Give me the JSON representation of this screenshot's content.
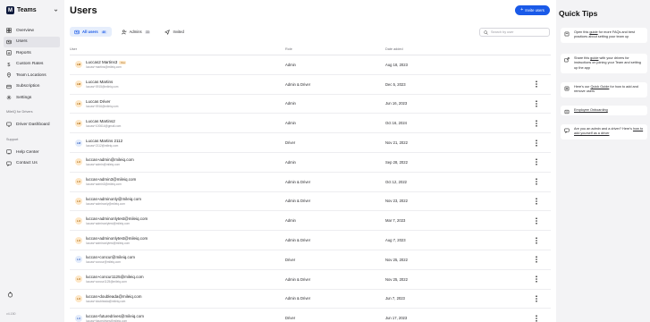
{
  "app": {
    "name": "Teams",
    "logo_letter": "M"
  },
  "sidebar": {
    "items": [
      {
        "label": "Overview",
        "icon": "grid-icon",
        "active": false
      },
      {
        "label": "Users",
        "icon": "users-icon",
        "active": true
      },
      {
        "label": "Reports",
        "icon": "chart-icon",
        "active": false
      },
      {
        "label": "Custom Rates",
        "icon": "dollar-icon",
        "active": false
      },
      {
        "label": "Team Locations",
        "icon": "pin-icon",
        "active": false
      },
      {
        "label": "Subscription",
        "icon": "card-icon",
        "active": false
      },
      {
        "label": "Settings",
        "icon": "gear-icon",
        "active": false
      }
    ],
    "drivers_section_label": "MileIQ for Drivers",
    "drivers_items": [
      {
        "label": "Driver Dashboard",
        "icon": "monitor-icon"
      }
    ],
    "support_section_label": "Support",
    "support_items": [
      {
        "label": "Help Center",
        "icon": "help-icon"
      },
      {
        "label": "Contact Us",
        "icon": "chat-icon"
      }
    ],
    "version": "v4.150"
  },
  "main": {
    "title": "Users",
    "invite_label": "Invite users",
    "tabs": [
      {
        "label": "All users",
        "count": "40",
        "active": true,
        "icon": "users-icon"
      },
      {
        "label": "Admins",
        "count": "33",
        "active": false,
        "icon": "admin-icon"
      },
      {
        "label": "Invited",
        "count": "",
        "active": false,
        "icon": "send-icon"
      }
    ],
    "search_placeholder": "Search by user",
    "columns": {
      "user": "User",
      "role": "Role",
      "date": "Date added"
    },
    "rows": [
      {
        "initials": "LM",
        "name": "Luccas2 Martins3",
        "email": "luccas+martins@mileiq.com",
        "you": true,
        "role": "Admin",
        "date": "Aug 18, 2023",
        "avatar_bg": "#fde7c7",
        "avatar_fg": "#b0690c"
      },
      {
        "initials": "LM",
        "name": "Luccas Martins",
        "email": "luccas+0915@mileiq.com",
        "you": false,
        "role": "Admin & Driver",
        "date": "Dec 5, 2023",
        "avatar_bg": "#fde7c7",
        "avatar_fg": "#b0690c"
      },
      {
        "initials": "LD",
        "name": "Luccas Driver",
        "email": "luccas+0916@mileiq.com",
        "you": false,
        "role": "Admin",
        "date": "Jun 16, 2023",
        "avatar_bg": "#fde7c7",
        "avatar_fg": "#b0690c"
      },
      {
        "initials": "LM",
        "name": "Luccas Martins2",
        "email": "luccas+100614@gmail.com",
        "you": false,
        "role": "Admin",
        "date": "Oct 16, 2024",
        "avatar_bg": "#fde7c7",
        "avatar_fg": "#b0690c"
      },
      {
        "initials": "LM",
        "name": "Luccas Martins 2112",
        "email": "luccas+2112@mileiq.com",
        "you": false,
        "role": "Driver",
        "date": "Nov 21, 2022",
        "avatar_bg": "#e2ebfb",
        "avatar_fg": "#3b67c4"
      },
      {
        "initials": "LU",
        "name": "luccas+admin@mileiq.com",
        "email": "luccas+admin@mileiq.com",
        "you": false,
        "role": "Admin",
        "date": "Sep 28, 2022",
        "avatar_bg": "#fde7c7",
        "avatar_fg": "#b0690c"
      },
      {
        "initials": "LU",
        "name": "luccas+admin3@mileiq.com",
        "email": "luccas+admin3@mileiq.com",
        "you": false,
        "role": "Admin & Driver",
        "date": "Oct 12, 2022",
        "avatar_bg": "#fde7c7",
        "avatar_fg": "#b0690c"
      },
      {
        "initials": "LU",
        "name": "luccas+adminonly@mileiq.com",
        "email": "luccas+adminonly@mileiq.com",
        "you": false,
        "role": "Admin & Driver",
        "date": "Nov 23, 2022",
        "avatar_bg": "#fde7c7",
        "avatar_fg": "#b0690c"
      },
      {
        "initials": "LU",
        "name": "luccas+adminonlytest@mileiq.com",
        "email": "luccas+adminonlytest@mileiq.com",
        "you": false,
        "role": "Admin",
        "date": "Mar 7, 2023",
        "avatar_bg": "#fde7c7",
        "avatar_fg": "#b0690c"
      },
      {
        "initials": "LU",
        "name": "luccas+adminonlytest@mileiq.com",
        "email": "luccas+adminonlytest@mileiq.com",
        "you": false,
        "role": "Admin & Driver",
        "date": "Aug 7, 2023",
        "avatar_bg": "#fde7c7",
        "avatar_fg": "#b0690c"
      },
      {
        "initials": "LU",
        "name": "luccas+concur@mileiq.com",
        "email": "luccas+concur@mileiq.com",
        "you": false,
        "role": "Driver",
        "date": "Nov 25, 2022",
        "avatar_bg": "#e2ebfb",
        "avatar_fg": "#3b67c4"
      },
      {
        "initials": "LU",
        "name": "luccas+concur1125@mileiq.com",
        "email": "luccas+concur1125@mileiq.com",
        "you": false,
        "role": "Admin & Driver",
        "date": "Nov 25, 2022",
        "avatar_bg": "#fde7c7",
        "avatar_fg": "#b0690c"
      },
      {
        "initials": "LU",
        "name": "luccas+doubleada@mileiq.com",
        "email": "luccas+doubleada@mileiq.com",
        "you": false,
        "role": "Admin & Driver",
        "date": "Jun 7, 2023",
        "avatar_bg": "#fde7c7",
        "avatar_fg": "#b0690c"
      },
      {
        "initials": "LU",
        "name": "luccas+futuredrives@mileiq.com",
        "email": "luccas+futuredrives@mileiq.com",
        "you": false,
        "role": "Driver",
        "date": "Jun 17, 2023",
        "avatar_bg": "#e2ebfb",
        "avatar_fg": "#3b67c4"
      }
    ],
    "you_badge": "You"
  },
  "quick_tips": {
    "title": "Quick Tips",
    "tips": [
      {
        "pre": "Open this ",
        "link": "guide",
        "post": " for more FAQs and best practices about setting your team up",
        "icon": "book-icon"
      },
      {
        "pre": "Share this ",
        "link": "guide",
        "post": " with your drivers for instructions on joining your Team and setting up the app",
        "icon": "share-icon"
      },
      {
        "pre": "Here's our ",
        "link": "Quick Guide",
        "post": " for how to add and remove users",
        "icon": "list-icon"
      },
      {
        "pre": "",
        "link": "Employee Onboarding",
        "post": "",
        "icon": "doc-icon"
      },
      {
        "pre": "Are you an admin and a driver? Here's ",
        "link": "how to add yourself as a driver",
        "post": "",
        "icon": "chat-icon"
      }
    ]
  },
  "colors": {
    "accent": "#1a5ae8",
    "brand": "#0e1a3c"
  }
}
